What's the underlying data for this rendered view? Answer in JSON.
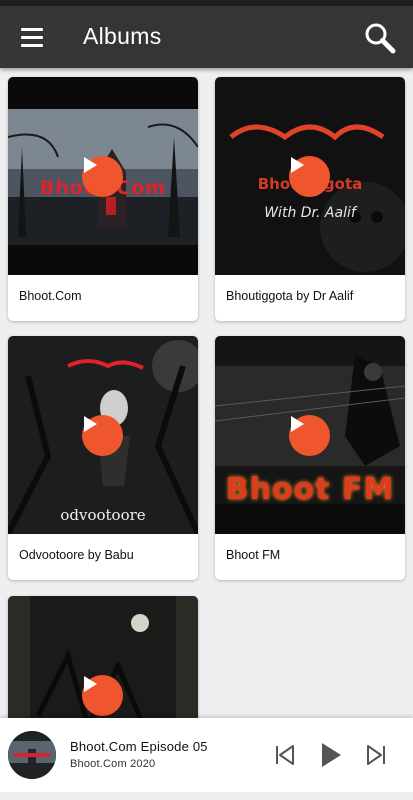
{
  "header": {
    "title": "Albums",
    "menu_icon": "hamburger-menu-icon",
    "search_icon": "search-icon",
    "bar_color": "#373533"
  },
  "albums": [
    {
      "caption": "Bhoot.Com",
      "art_text": "Bhoot.Com"
    },
    {
      "caption": "Bhoutiggota by Dr Aalif",
      "art_text": "Bhoutiggota",
      "art_subtext": "With Dr. Aalif"
    },
    {
      "caption": "Odvootoore by Babu",
      "art_text": "odvootoore"
    },
    {
      "caption": "Bhoot FM",
      "art_text": "Bhoot FM"
    },
    {
      "caption": ""
    }
  ],
  "play_button_color": "#f0562d",
  "player": {
    "title": "Bhoot.Com Episode 05",
    "subtitle": "Bhoot.Com 2020",
    "controls": [
      "skip-previous-icon",
      "play-icon",
      "skip-next-icon"
    ]
  }
}
